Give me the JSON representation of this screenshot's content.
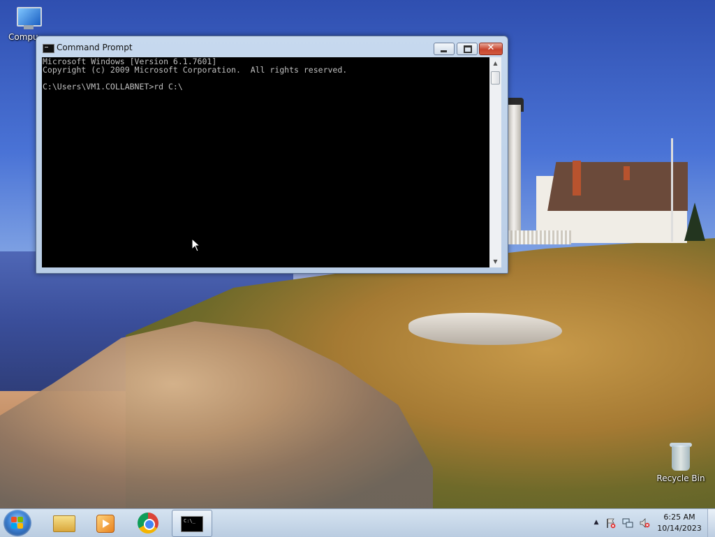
{
  "desktop": {
    "icons": [
      {
        "label": "Compu"
      },
      {
        "label": "Recycle Bin"
      }
    ]
  },
  "window": {
    "title": "Command Prompt",
    "console_lines": [
      "Microsoft Windows [Version 6.1.7601]",
      "Copyright (c) 2009 Microsoft Corporation.  All rights reserved.",
      "",
      "C:\\Users\\VM1.COLLABNET>rd C:\\"
    ],
    "buttons": {
      "close": "✕"
    }
  },
  "taskbar": {
    "apps": [
      "explorer-icon",
      "media-player-icon",
      "chrome-icon",
      "command-prompt-icon"
    ],
    "cmd_glyph": "C:\\_",
    "clock": {
      "time": "6:25 AM",
      "date": "10/14/2023"
    },
    "tray_arrow": "▲"
  },
  "colors": {
    "console_bg": "#000000",
    "console_fg": "#c0c0c0",
    "close_button": "#c7452f"
  }
}
